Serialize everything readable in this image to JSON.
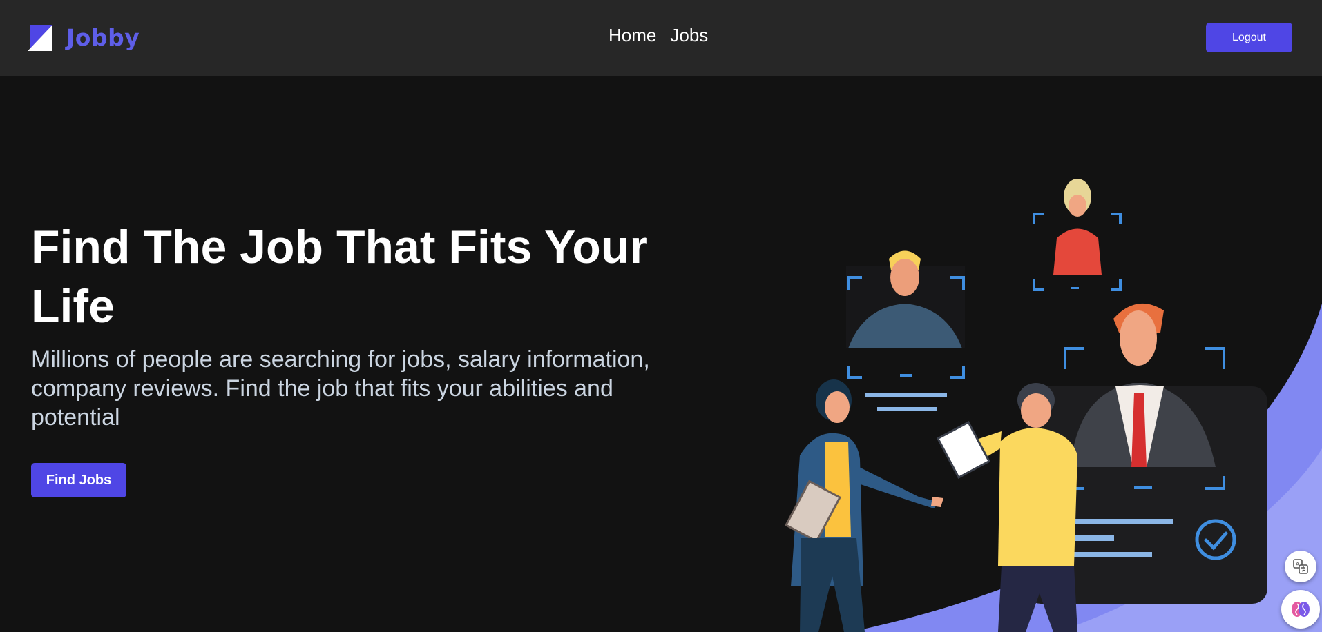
{
  "brand": {
    "name": "Jobby",
    "logo_icon": "jobby-logo-icon",
    "accent_color": "#5e5ee8"
  },
  "nav": {
    "links": [
      {
        "label": "Home"
      },
      {
        "label": "Jobs"
      }
    ],
    "logout_label": "Logout"
  },
  "hero": {
    "title": "Find The Job That Fits Your Life",
    "description": "Millions of people are searching for jobs, salary information, company reviews. Find the job that fits your abilities and potential",
    "cta_label": "Find Jobs",
    "illustration": "job-interview-illustration"
  },
  "floating_buttons": [
    {
      "icon": "translate-icon"
    },
    {
      "icon": "brain-icon"
    }
  ],
  "colors": {
    "primary_button": "#4f46e5",
    "navbar_bg": "#272727",
    "page_bg": "#121212"
  }
}
